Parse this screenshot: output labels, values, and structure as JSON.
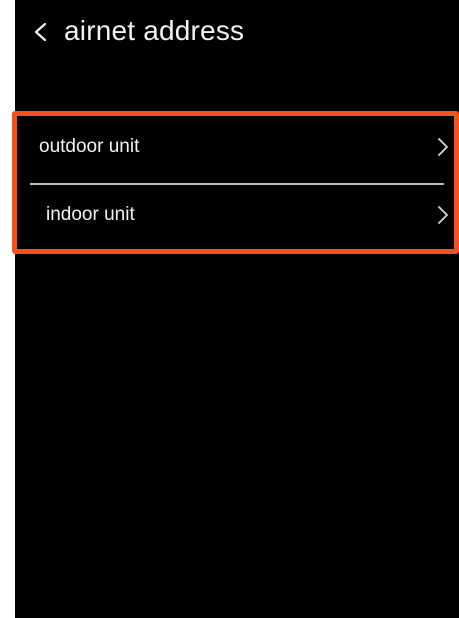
{
  "header": {
    "title": "airnet address",
    "back_icon": "chevron-left-icon"
  },
  "items": [
    {
      "label": "outdoor unit",
      "icon": "chevron-right-icon"
    },
    {
      "label": "indoor unit",
      "icon": "chevron-right-icon"
    }
  ],
  "colors": {
    "background": "#000000",
    "text": "#f2f2f2",
    "highlight": "#f4511e",
    "divider": "#bdbdbd"
  }
}
